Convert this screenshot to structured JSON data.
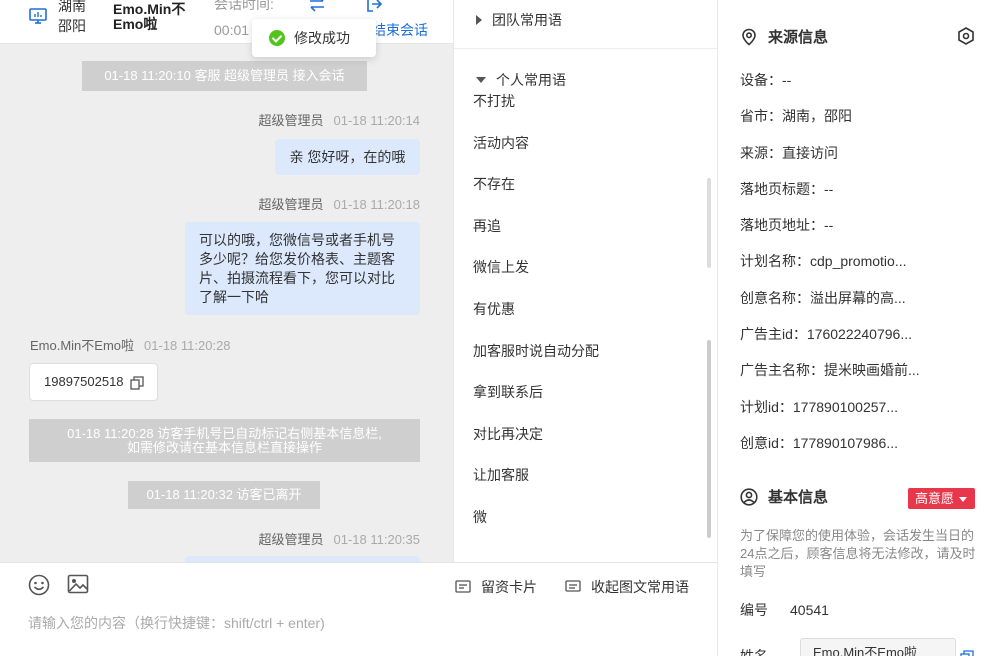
{
  "header": {
    "location_province": "湖南",
    "location_city": "邵阳",
    "visitor_name": "Emo.Min不Emo啦",
    "session_time_label": "会话时间:",
    "session_time_value": "00:01",
    "end_session_label": "结束会话"
  },
  "toast": {
    "text": "修改成功"
  },
  "chat": {
    "sys_join": "01-18 11:20:10 客服 超级管理员 接入会话",
    "msg1_sender": "超级管理员",
    "msg1_time": "01-18 11:20:14",
    "msg1_text": "亲 您好呀，在的哦",
    "msg2_sender": "超级管理员",
    "msg2_time": "01-18 11:20:18",
    "msg2_text": "可以的哦，您微信号或者手机号多少呢？给您发价格表、主题客片、拍摄流程看下，您可以对比了解一下哈",
    "msg3_sender": "Emo.Min不Emo啦",
    "msg3_time": "01-18 11:20:28",
    "msg3_text": "19897502518",
    "sys_phone_line1": "01-18 11:20:28 访客手机号已自动标记右侧基本信息栏,",
    "sys_phone_line2": "如需修改请在基本信息栏直接操作",
    "sys_left": "01-18 11:20:32 访客已离开",
    "msg4_sender": "超级管理员",
    "msg4_time": "01-18 11:20:35"
  },
  "composer": {
    "card_label": "留资卡片",
    "fold_label": "收起图文常用语",
    "placeholder": "请输入您的内容（换行快捷键：shift/ctrl + enter)"
  },
  "phrases": {
    "team_group": "团队常用语",
    "personal_group": "个人常用语",
    "items": [
      "不打扰",
      "活动内容",
      "不存在",
      "再追",
      "微信上发",
      "有优惠",
      "加客服时说自动分配",
      "拿到联系后",
      "对比再决定",
      "让加客服",
      "微"
    ]
  },
  "info": {
    "source_title": "来源信息",
    "source_rows": [
      "设备：--",
      "省市：湖南，邵阳",
      "来源：直接访问",
      "落地页标题：--",
      "落地页地址：--",
      "计划名称：cdp_promotio...",
      "创意名称：溢出屏幕的高...",
      "广告主id：176022240796...",
      "广告主名称：提米映画婚前...",
      "计划id：177890100257...",
      "创意id：177890107986..."
    ],
    "basic_title": "基本信息",
    "intent_badge": "高意愿",
    "notice": "为了保障您的使用体验，会话发生当日的24点之后，顾客信息将无法修改，请及时填写",
    "id_label": "编号",
    "id_value": "40541",
    "name_label": "姓名",
    "name_value": "Emo.Min不Emo啦"
  },
  "colors": {
    "accent_blue": "#1e6fd9",
    "bubble_blue": "#dce8fc",
    "badge_red": "#e8364a",
    "success_green": "#52c41a"
  }
}
